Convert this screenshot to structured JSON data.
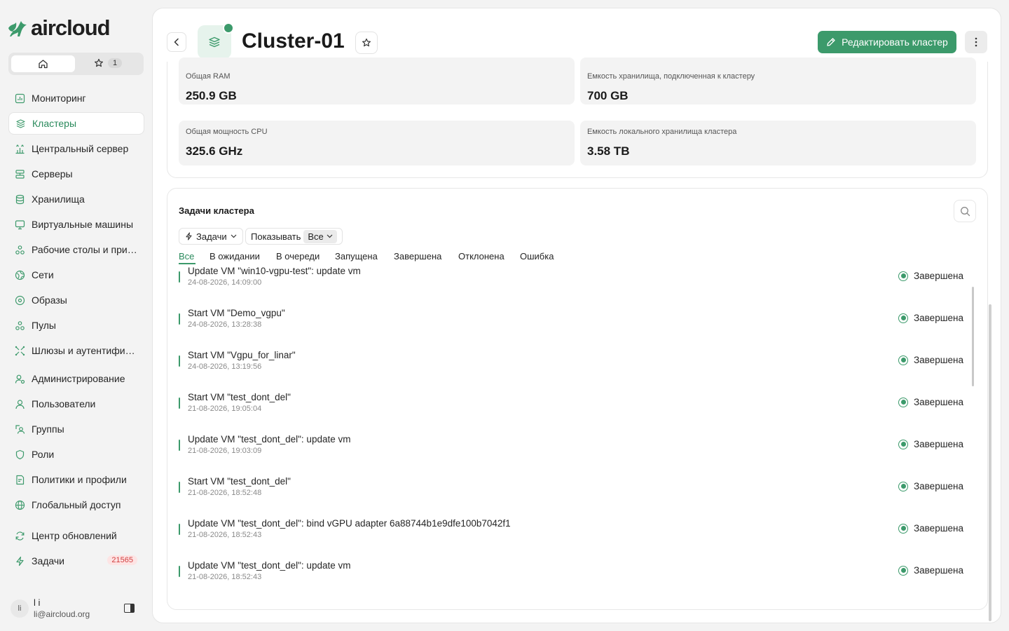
{
  "brand": {
    "name": "aircloud",
    "accent": "#3c9a6b"
  },
  "quick": {
    "favorites_count": "1"
  },
  "nav": [
    {
      "label": "Мониторинг",
      "icon": "chart-icon"
    },
    {
      "label": "Кластеры",
      "icon": "layers-icon",
      "active": true
    },
    {
      "label": "Центральный сервер",
      "icon": "network-icon"
    },
    {
      "label": "Серверы",
      "icon": "server-icon"
    },
    {
      "label": "Хранилища",
      "icon": "database-icon"
    },
    {
      "label": "Виртуальные машины",
      "icon": "monitor-icon"
    },
    {
      "label": "Рабочие столы и прил...",
      "icon": "apps-icon"
    },
    {
      "label": "Сети",
      "icon": "globe-icon"
    },
    {
      "label": "Образы",
      "icon": "disc-icon"
    },
    {
      "label": "Пулы",
      "icon": "pools-icon"
    },
    {
      "label": "Шлюзы и аутентифика...",
      "icon": "gateway-icon"
    },
    {
      "label": "Администрирование",
      "icon": "admin-icon"
    },
    {
      "label": "Пользователи",
      "icon": "user-icon"
    },
    {
      "label": "Группы",
      "icon": "group-icon"
    },
    {
      "label": "Роли",
      "icon": "shield-icon"
    },
    {
      "label": "Политики и профили",
      "icon": "policy-icon"
    },
    {
      "label": "Глобальный доступ",
      "icon": "globe2-icon"
    },
    {
      "label": "Центр обновлений",
      "icon": "refresh-icon"
    },
    {
      "label": "Задачи",
      "icon": "bolt-icon",
      "badge": "21565"
    }
  ],
  "user": {
    "initials": "li",
    "name": "l i",
    "email": "li@aircloud.org"
  },
  "header": {
    "title": "Cluster-01",
    "edit_label": "Редактировать кластер"
  },
  "stats": [
    {
      "label": "Общая RAM",
      "value": "250.9 GB"
    },
    {
      "label": "Емкость хранилища, подключенная к кластеру",
      "value": "700 GB"
    },
    {
      "label": "Общая мощность CPU",
      "value": "325.6 GHz"
    },
    {
      "label": "Емкость локального хранилища кластера",
      "value": "3.58 TB"
    }
  ],
  "tasks": {
    "title": "Задачи кластера",
    "filter_tasks": "Задачи",
    "filter_show_label": "Показывать",
    "filter_show_value": "Все",
    "tabs": [
      "Все",
      "В ожидании",
      "В очереди",
      "Запущена",
      "Завершена",
      "Отклонена",
      "Ошибка"
    ],
    "rows": [
      {
        "title": "Update VM \"win10-vgpu-test\": update vm",
        "time": "24-08-2026, 14:09:00",
        "status": "Завершена"
      },
      {
        "title": "Start VM \"Demo_vgpu\"",
        "time": "24-08-2026, 13:28:38",
        "status": "Завершена"
      },
      {
        "title": "Start VM \"Vgpu_for_linar\"",
        "time": "24-08-2026, 13:19:56",
        "status": "Завершена"
      },
      {
        "title": "Start VM \"test_dont_del\"",
        "time": "21-08-2026, 19:05:04",
        "status": "Завершена"
      },
      {
        "title": "Update VM \"test_dont_del\": update vm",
        "time": "21-08-2026, 19:03:09",
        "status": "Завершена"
      },
      {
        "title": "Start VM \"test_dont_del\"",
        "time": "21-08-2026, 18:52:48",
        "status": "Завершена"
      },
      {
        "title": "Update VM \"test_dont_del\": bind vGPU adapter 6a88744b1e9dfe100b7042f1",
        "time": "21-08-2026, 18:52:43",
        "status": "Завершена"
      },
      {
        "title": "Update VM \"test_dont_del\": update vm",
        "time": "21-08-2026, 18:52:43",
        "status": "Завершена"
      }
    ]
  }
}
